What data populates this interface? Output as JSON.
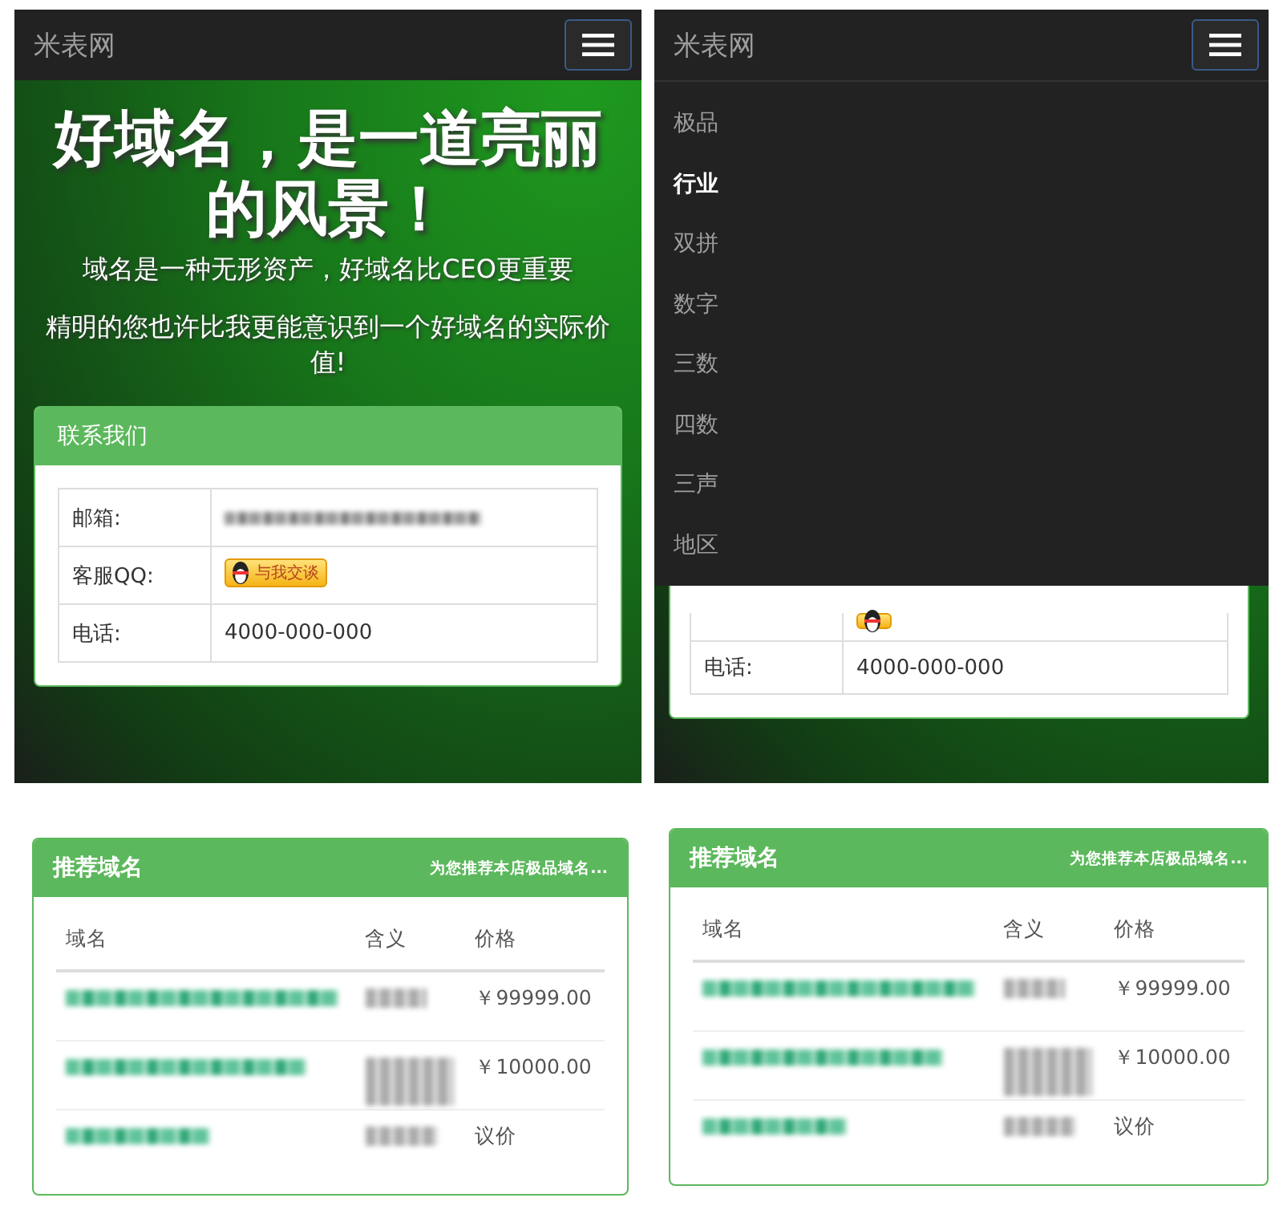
{
  "home_screen": {
    "navbar": {
      "brand": "米表网"
    },
    "hero": {
      "title": "好域名，是一道亮丽的风景！",
      "subtitle": "域名是一种无形资产，好域名比CEO更重要",
      "tagline": "精明的您也许比我更能意识到一个好域名的实际价值!"
    },
    "contact": {
      "title": "联系我们",
      "rows": [
        {
          "kind": "blurred",
          "label": "邮箱:"
        },
        {
          "kind": "qq",
          "label": "客服QQ:",
          "button": "与我交谈"
        },
        {
          "kind": "text",
          "label": "电话:",
          "value": "4000-000-000"
        }
      ]
    }
  },
  "menu_screen": {
    "navbar": {
      "brand": "米表网"
    },
    "menu": [
      {
        "label": "极品",
        "selected": false
      },
      {
        "label": "行业",
        "selected": true
      },
      {
        "label": "双拼",
        "selected": false
      },
      {
        "label": "数字",
        "selected": false
      },
      {
        "label": "三数",
        "selected": false
      },
      {
        "label": "四数",
        "selected": false
      },
      {
        "label": "三声",
        "selected": false
      },
      {
        "label": "地区",
        "selected": false
      }
    ],
    "contact_rows": [
      {
        "kind": "qq"
      },
      {
        "kind": "text",
        "label": "电话:",
        "value": "4000-000-000"
      }
    ]
  },
  "domain_cards": [
    {
      "title": "推荐域名",
      "note": "为您推荐本店极品域名...",
      "columns": [
        "域名",
        "含义",
        "价格"
      ],
      "rows": [
        {
          "price": "￥99999.00"
        },
        {
          "price": "￥10000.00"
        },
        {
          "price": "议价"
        }
      ]
    },
    {
      "title": "推荐域名",
      "note": "为您推荐本店极品域名...",
      "columns": [
        "域名",
        "含义",
        "价格"
      ],
      "rows": [
        {
          "price": "￥99999.00"
        },
        {
          "price": "￥10000.00"
        },
        {
          "price": "议价"
        }
      ]
    }
  ]
}
